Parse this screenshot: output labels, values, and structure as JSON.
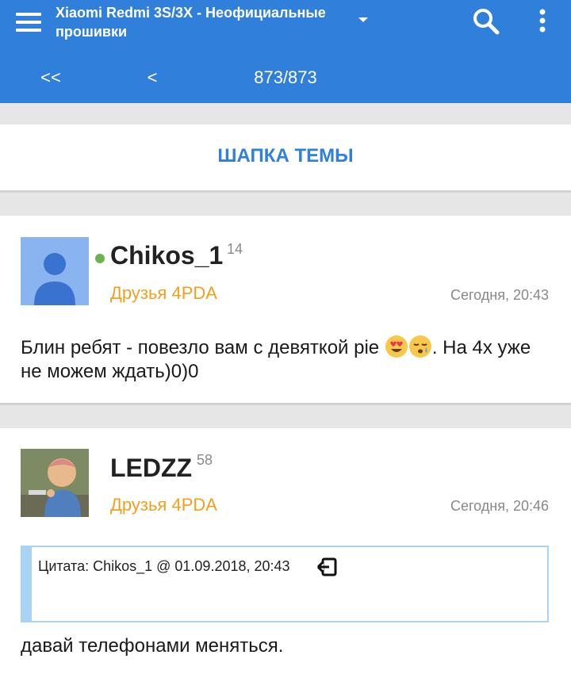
{
  "appbar": {
    "title": "Xiaomi Redmi 3S/3X - Неофициальные прошивки",
    "nav_first": "<<",
    "nav_prev": "<",
    "page": "873/873"
  },
  "header_link": "ШАПКА ТЕМЫ",
  "posts": [
    {
      "username": "Chikos_1",
      "reputation": "14",
      "group": "Друзья 4PDA",
      "time": "Сегодня, 20:43",
      "online": true,
      "text_before": "Блин ребят - повезло вам с девяткой pie ",
      "emojis": [
        "heart-eyes-emoji",
        "sleepy-emoji"
      ],
      "text_after": ". На 4х уже не можем ждать)0)0"
    },
    {
      "username": "LEDZZ",
      "reputation": "58",
      "group": "Друзья 4PDA",
      "time": "Сегодня, 20:46",
      "quote": "Цитата: Chikos_1 @ 01.09.2018, 20:43",
      "text": "давай телефонами меняться."
    }
  ],
  "colors": {
    "appbar": "#2f7fdb",
    "link": "#2f7fdb",
    "group": "#f0a020",
    "online": "#6bb34a",
    "quote_border": "#a9d3f3"
  }
}
